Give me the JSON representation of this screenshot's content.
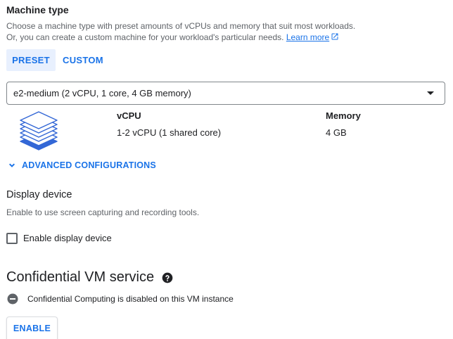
{
  "machine_type": {
    "heading": "Machine type",
    "description_line1": "Choose a machine type with preset amounts of vCPUs and memory that suit most workloads.",
    "description_line2": "Or, you can create a custom machine for your workload's particular needs.",
    "learn_more": "Learn more",
    "tabs": [
      {
        "label": "PRESET",
        "selected": true
      },
      {
        "label": "CUSTOM",
        "selected": false
      }
    ],
    "selected_machine": "e2-medium (2 vCPU, 1 core, 4 GB memory)",
    "specs": {
      "vcpu_header": "vCPU",
      "vcpu_value": "1-2 vCPU (1 shared core)",
      "memory_header": "Memory",
      "memory_value": "4 GB"
    },
    "advanced_label": "ADVANCED CONFIGURATIONS"
  },
  "display_device": {
    "heading": "Display device",
    "description": "Enable to use screen capturing and recording tools.",
    "checkbox_label": "Enable display device",
    "checked": false
  },
  "confidential_vm": {
    "heading": "Confidential VM service",
    "status": "Confidential Computing is disabled on this VM instance",
    "enable_button": "ENABLE"
  },
  "icons": {
    "external_link": "external-link-icon",
    "dropdown": "caret-down-icon",
    "machine": "layers-stack-icon",
    "expand": "chevron-down-icon",
    "help": "help-circle-icon",
    "status": "disabled-minus-circle-icon"
  },
  "colors": {
    "accent": "#1a73e8",
    "selected_tab_bg": "#e8f0fe",
    "text_primary": "#202124",
    "text_secondary": "#5f6368",
    "stack_fill": "#3367d6"
  }
}
